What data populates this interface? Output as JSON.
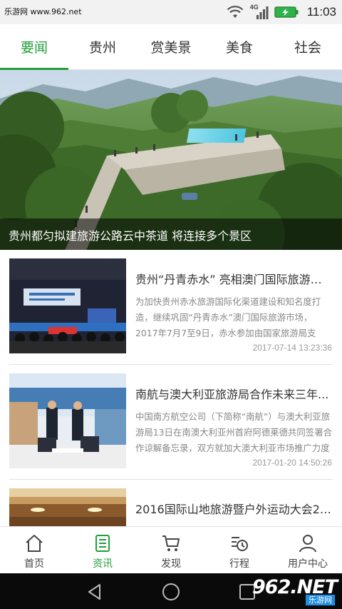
{
  "status_bar": {
    "watermark": "乐游网 www.962.net",
    "network": "4G",
    "time": "11:03"
  },
  "tabs": [
    {
      "label": "要闻",
      "active": true
    },
    {
      "label": "贵州",
      "active": false
    },
    {
      "label": "赏美景",
      "active": false
    },
    {
      "label": "美食",
      "active": false
    },
    {
      "label": "社会",
      "active": false
    }
  ],
  "hero": {
    "caption": "贵州都匀拟建旅游公路云中茶道 将连接多个景区"
  },
  "articles": [
    {
      "title": "贵州“丹青赤水” 亮相澳门国际旅游博...",
      "summary": "为加快贵州赤水旅游国际化渠道建设和知名度打造，继续巩固“丹青赤水”澳门国际旅游市场，2017年7月7至9日，赤水参加由国家旅游局支持，澳门特区",
      "date": "2017-07-14 13:23:36"
    },
    {
      "title": "南航与澳大利亚旅游局合作未来三年...",
      "summary": "中国南方航空公司（下简称“南航”）与澳大利亚旅游局13日在南澳大利亚州首府阿德莱德共同签署合作谅解备忘录，双方就加大澳大利亚市场推广力度",
      "date": "2017-01-20 14:50:26"
    },
    {
      "title": "2016国际山地旅游暨户外运动大会22...",
      "summary": "",
      "date": ""
    }
  ],
  "bottom_nav": [
    {
      "label": "首页",
      "icon": "home-icon",
      "active": false
    },
    {
      "label": "资讯",
      "icon": "news-icon",
      "active": true
    },
    {
      "label": "发现",
      "icon": "cart-icon",
      "active": false
    },
    {
      "label": "行程",
      "icon": "schedule-icon",
      "active": false
    },
    {
      "label": "用户中心",
      "icon": "user-icon",
      "active": false
    }
  ],
  "watermark": {
    "brand": "962.NET",
    "sub": "乐游网"
  },
  "colors": {
    "accent": "#20a03a",
    "battery": "#2eb34a"
  }
}
